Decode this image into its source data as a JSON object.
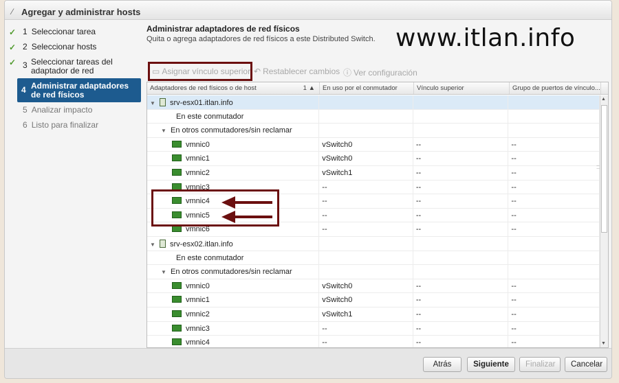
{
  "dialog": {
    "title": "Agregar y administrar hosts"
  },
  "nav": {
    "steps": [
      {
        "num": "1",
        "label": "Seleccionar tarea",
        "state": "done"
      },
      {
        "num": "2",
        "label": "Seleccionar hosts",
        "state": "done"
      },
      {
        "num": "3",
        "label": "Seleccionar tareas del adaptador de red",
        "state": "done"
      },
      {
        "num": "4",
        "label": "Administrar adaptadores de red físicos",
        "state": "active"
      },
      {
        "num": "5",
        "label": "Analizar impacto",
        "state": "pending"
      },
      {
        "num": "6",
        "label": "Listo para finalizar",
        "state": "pending"
      }
    ]
  },
  "main": {
    "title": "Administrar adaptadores de red físicos",
    "subtitle": "Quita o agrega adaptadores de red físicos a este Distributed Switch.",
    "watermark": "www.itlan.info",
    "toolbar": {
      "assign": "Asignar vínculo superior",
      "reset": "Restablecer cambios",
      "view": "Ver configuración"
    }
  },
  "grid": {
    "headers": [
      "Adaptadores de red físicos o de host",
      "En uso por el conmutador",
      "Vínculo superior",
      "Grupo de puertos de vínculo..."
    ],
    "sort_indicator": "1 ▲",
    "rows": [
      {
        "kind": "host",
        "name": "srv-esx01.itlan.info",
        "switch": "",
        "uplink": "",
        "group": ""
      },
      {
        "kind": "group",
        "name": "En este conmutador",
        "switch": "",
        "uplink": "",
        "group": ""
      },
      {
        "kind": "subgroup",
        "name": "En otros conmutadores/sin reclamar",
        "switch": "",
        "uplink": "",
        "group": ""
      },
      {
        "kind": "nic",
        "name": "vmnic0",
        "switch": "vSwitch0",
        "uplink": "--",
        "group": "--"
      },
      {
        "kind": "nic",
        "name": "vmnic1",
        "switch": "vSwitch0",
        "uplink": "--",
        "group": "--"
      },
      {
        "kind": "nic",
        "name": "vmnic2",
        "switch": "vSwitch1",
        "uplink": "--",
        "group": "--"
      },
      {
        "kind": "nic",
        "name": "vmnic3",
        "switch": "--",
        "uplink": "--",
        "group": "--"
      },
      {
        "kind": "nic",
        "name": "vmnic4",
        "switch": "--",
        "uplink": "--",
        "group": "--"
      },
      {
        "kind": "nic",
        "name": "vmnic5",
        "switch": "--",
        "uplink": "--",
        "group": "--"
      },
      {
        "kind": "nic",
        "name": "vmnic6",
        "switch": "--",
        "uplink": "--",
        "group": "--"
      },
      {
        "kind": "host",
        "name": "srv-esx02.itlan.info",
        "switch": "",
        "uplink": "",
        "group": ""
      },
      {
        "kind": "group",
        "name": "En este conmutador",
        "switch": "",
        "uplink": "",
        "group": ""
      },
      {
        "kind": "subgroup",
        "name": "En otros conmutadores/sin reclamar",
        "switch": "",
        "uplink": "",
        "group": ""
      },
      {
        "kind": "nic",
        "name": "vmnic0",
        "switch": "vSwitch0",
        "uplink": "--",
        "group": "--"
      },
      {
        "kind": "nic",
        "name": "vmnic1",
        "switch": "vSwitch0",
        "uplink": "--",
        "group": "--"
      },
      {
        "kind": "nic",
        "name": "vmnic2",
        "switch": "vSwitch1",
        "uplink": "--",
        "group": "--"
      },
      {
        "kind": "nic",
        "name": "vmnic3",
        "switch": "--",
        "uplink": "--",
        "group": "--"
      },
      {
        "kind": "nic",
        "name": "vmnic4",
        "switch": "--",
        "uplink": "--",
        "group": "--"
      }
    ]
  },
  "footer": {
    "back": "Atrás",
    "next": "Siguiente",
    "finish": "Finalizar",
    "cancel": "Cancelar"
  },
  "colors": {
    "accent": "#1d5b8f",
    "highlight": "#6b0f0f",
    "done_check": "#4f9a2c"
  }
}
